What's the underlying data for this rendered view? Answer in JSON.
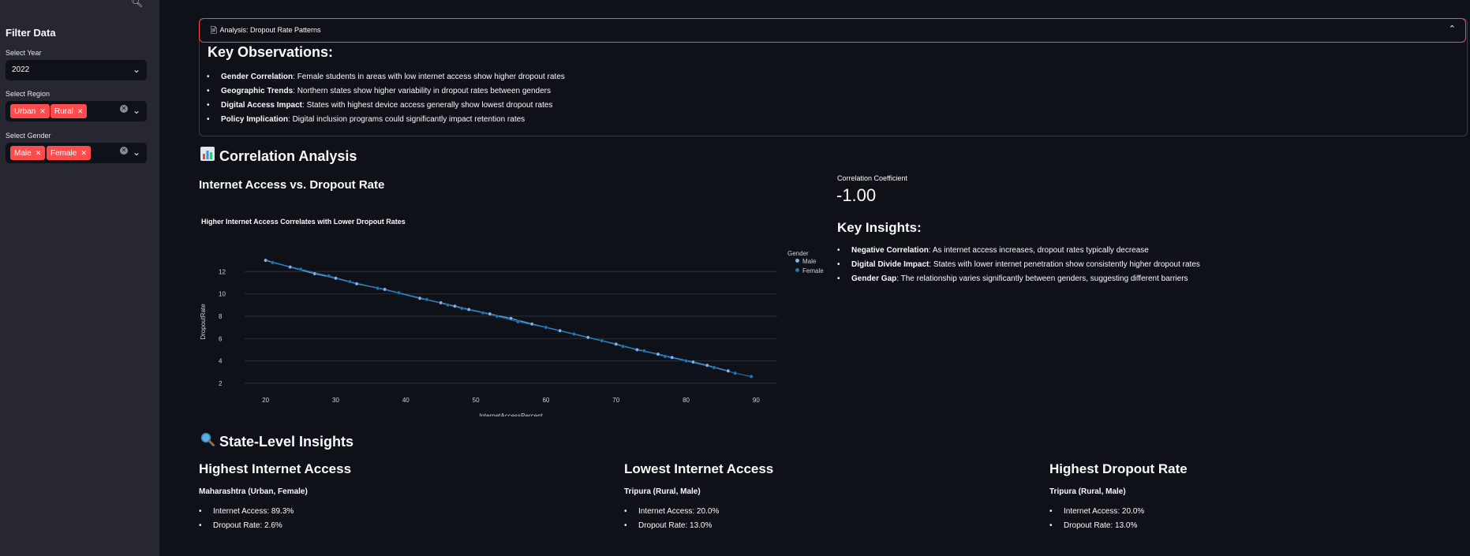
{
  "sidebar": {
    "title": "Filter Data",
    "year": {
      "label": "Select Year",
      "value": "2022"
    },
    "region": {
      "label": "Select Region",
      "chips": [
        "Urban",
        "Rural"
      ]
    },
    "gender": {
      "label": "Select Gender",
      "chips": [
        "Male",
        "Female"
      ]
    }
  },
  "expander": {
    "title": "Analysis: Dropout Rate Patterns",
    "heading": "Key Observations:",
    "items": [
      {
        "bold": "Gender Correlation",
        "text": ": Female students in areas with low internet access show higher dropout rates"
      },
      {
        "bold": "Geographic Trends",
        "text": ": Northern states show higher variability in dropout rates between genders"
      },
      {
        "bold": "Digital Access Impact",
        "text": ": States with highest device access generally show lowest dropout rates"
      },
      {
        "bold": "Policy Implication",
        "text": ": Digital inclusion programs could significantly impact retention rates"
      }
    ]
  },
  "correlation": {
    "heading": "Correlation Analysis",
    "subheading": "Internet Access vs. Dropout Rate",
    "coef_label": "Correlation Coefficient",
    "coef_value": "-1.00",
    "insights_heading": "Key Insights:",
    "insights": [
      {
        "bold": "Negative Correlation",
        "text": ": As internet access increases, dropout rates typically decrease"
      },
      {
        "bold": "Digital Divide Impact",
        "text": ": States with lower internet penetration show consistently higher dropout rates"
      },
      {
        "bold": "Gender Gap",
        "text": ": The relationship varies significantly between genders, suggesting different barriers"
      }
    ]
  },
  "chart_data": {
    "type": "scatter",
    "title": "Higher Internet Access Correlates with Lower Dropout Rates",
    "xlabel": "InternetAccessPercent",
    "ylabel": "DropoutRate",
    "xlim": [
      17,
      93
    ],
    "ylim": [
      1.5,
      13.5
    ],
    "xticks": [
      20,
      30,
      40,
      50,
      60,
      70,
      80,
      90
    ],
    "yticks": [
      2,
      4,
      6,
      8,
      10,
      12
    ],
    "legend_title": "Gender",
    "legend_position": "top-right",
    "grid": true,
    "series": [
      {
        "name": "Male",
        "color": "#7fb3f5",
        "x": [
          20,
          23.5,
          27,
          30,
          33,
          37,
          42,
          45,
          47,
          49,
          52,
          55,
          58,
          62,
          66,
          70,
          73,
          76,
          78,
          81,
          83,
          86
        ],
        "y": [
          13.0,
          12.4,
          11.8,
          11.4,
          10.9,
          10.4,
          9.6,
          9.2,
          8.9,
          8.6,
          8.2,
          7.8,
          7.3,
          6.7,
          6.1,
          5.5,
          5.0,
          4.6,
          4.3,
          3.9,
          3.6,
          3.1
        ]
      },
      {
        "name": "Female",
        "color": "#1f77b4",
        "x": [
          21,
          25,
          29,
          32,
          36,
          39,
          43,
          46,
          48,
          51,
          53,
          56,
          60,
          64,
          68,
          71,
          74,
          77,
          80,
          84,
          87,
          89.3
        ],
        "y": [
          12.8,
          12.2,
          11.6,
          11.1,
          10.5,
          10.1,
          9.5,
          9.0,
          8.7,
          8.3,
          8.0,
          7.5,
          7.0,
          6.4,
          5.8,
          5.3,
          4.9,
          4.4,
          4.0,
          3.4,
          2.9,
          2.6
        ]
      }
    ]
  },
  "state": {
    "heading": "State-Level Insights",
    "cards": [
      {
        "title": "Highest Internet Access",
        "sub": "Maharashtra (Urban, Female)",
        "items": [
          "Internet Access: 89.3%",
          "Dropout Rate: 2.6%"
        ]
      },
      {
        "title": "Lowest Internet Access",
        "sub": "Tripura (Rural, Male)",
        "items": [
          "Internet Access: 20.0%",
          "Dropout Rate: 13.0%"
        ]
      },
      {
        "title": "Highest Dropout Rate",
        "sub": "Tripura (Rural, Male)",
        "items": [
          "Internet Access: 20.0%",
          "Dropout Rate: 13.0%"
        ]
      }
    ]
  }
}
